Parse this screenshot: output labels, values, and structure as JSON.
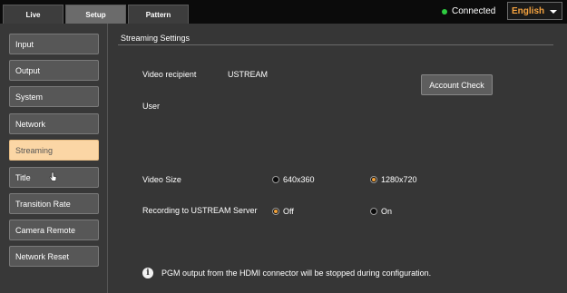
{
  "tabs": [
    {
      "label": "Live",
      "active": false
    },
    {
      "label": "Setup",
      "active": true
    },
    {
      "label": "Pattern",
      "active": false
    }
  ],
  "status": {
    "text": "Connected",
    "dot_color": "#2ecc40"
  },
  "language": {
    "selected": "English",
    "color": "#f5a340"
  },
  "sidebar": {
    "items": [
      {
        "label": "Input"
      },
      {
        "label": "Output"
      },
      {
        "label": "System"
      },
      {
        "label": "Network"
      },
      {
        "label": "Streaming",
        "active": true
      },
      {
        "label": "Title"
      },
      {
        "label": "Transition Rate"
      },
      {
        "label": "Camera Remote"
      },
      {
        "label": "Network Reset"
      }
    ]
  },
  "main": {
    "section_title": "Streaming Settings",
    "video_recipient_label": "Video recipient",
    "video_recipient_value": "USTREAM",
    "account_check_label": "Account Check",
    "user_label": "User",
    "video_size": {
      "label": "Video Size",
      "options": [
        {
          "label": "640x360",
          "checked": false
        },
        {
          "label": "1280x720",
          "checked": true
        }
      ]
    },
    "recording": {
      "label": "Recording to USTREAM Server",
      "options": [
        {
          "label": "Off",
          "checked": true
        },
        {
          "label": "On",
          "checked": false
        }
      ]
    },
    "info_text": "PGM output from the HDMI connector will be stopped during configuration.",
    "accent_color": "#f0a23c"
  }
}
